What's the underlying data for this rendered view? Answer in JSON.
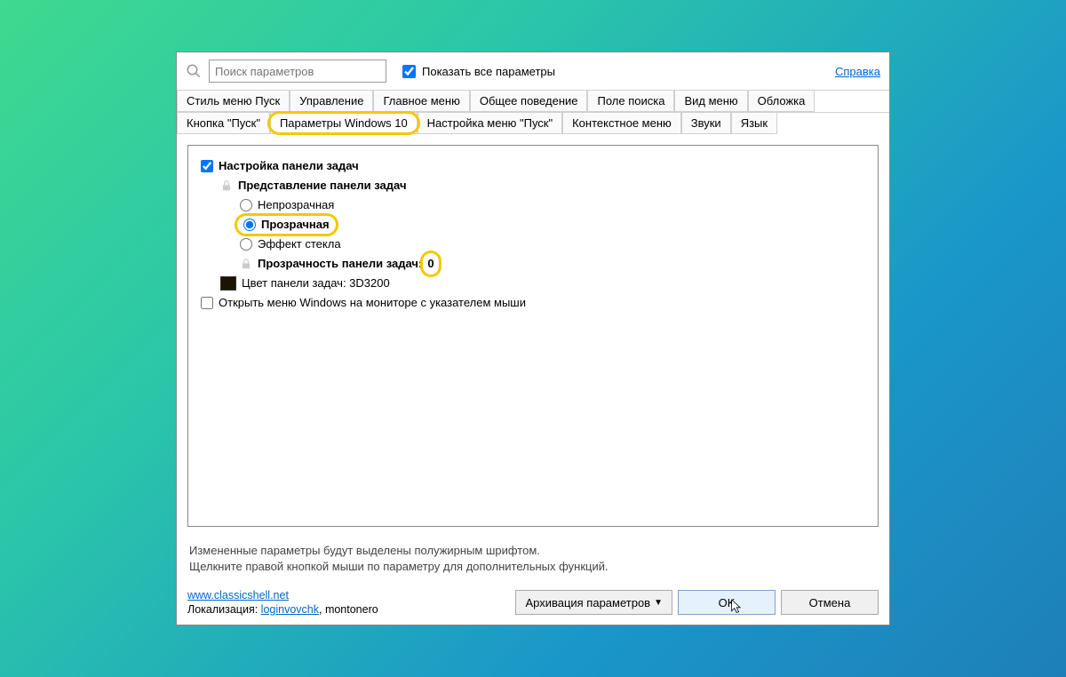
{
  "topbar": {
    "search_placeholder": "Поиск параметров",
    "show_all_label": "Показать все параметры",
    "help_label": "Справка"
  },
  "tabs_row1": [
    "Стиль меню Пуск",
    "Управление",
    "Главное меню",
    "Общее поведение",
    "Поле поиска",
    "Вид меню",
    "Обложка"
  ],
  "tabs_row2": [
    "Кнопка \"Пуск\"",
    "Параметры Windows 10",
    "Настройка меню \"Пуск\"",
    "Контекстное меню",
    "Звуки",
    "Язык"
  ],
  "tree": {
    "taskbar_settings": "Настройка панели задач",
    "taskbar_appearance": "Представление панели задач",
    "opaque": "Непрозрачная",
    "transparent": "Прозрачная",
    "glass": "Эффект стекла",
    "opacity_label": "Прозрачность панели задач:",
    "opacity_value": "0",
    "color_label": "Цвет панели задач: 3D3200",
    "open_on_mouse_monitor": "Открыть меню Windows на мониторе с указателем мыши"
  },
  "hints": {
    "line1": "Измененные параметры будут выделены полужирным шрифтом.",
    "line2": "Щелкните правой кнопкой мыши по параметру для дополнительных функций."
  },
  "bottom": {
    "website": "www.classicshell.net",
    "localization_prefix": "Локализация: ",
    "localization_link": "loginvovchk",
    "localization_suffix": ", montonero",
    "archive_btn": "Архивация параметров",
    "ok_btn": "OK",
    "cancel_btn": "Отмена"
  }
}
